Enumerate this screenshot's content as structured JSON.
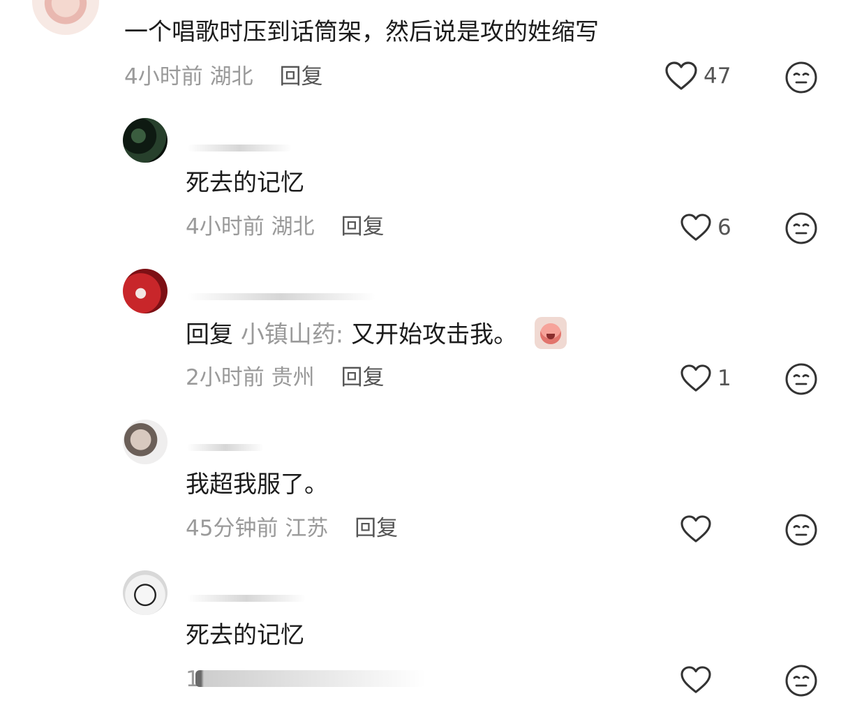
{
  "comments": [
    {
      "text": "一个唱歌时压到话筒架，然后说是攻的姓缩写",
      "time": "4小时前",
      "location": "湖北",
      "reply_label": "回复",
      "likes": "47"
    },
    {
      "text": "死去的记忆",
      "time": "4小时前",
      "location": "湖北",
      "reply_label": "回复",
      "likes": "6"
    },
    {
      "reply_prefix": "回复",
      "reply_target": "小镇山药:",
      "text": "又开始攻击我。",
      "time": "2小时前",
      "location": "贵州",
      "reply_label": "回复",
      "likes": "1"
    },
    {
      "text": "我超我服了。",
      "time": "45分钟前",
      "location": "江苏",
      "reply_label": "回复",
      "likes": ""
    },
    {
      "text": "死去的记忆",
      "time": "1",
      "likes": ""
    }
  ],
  "icons": {
    "like": "heart-outline-icon",
    "dislike": "neutral-face-icon",
    "sticker": "crying-face-sticker"
  },
  "colors": {
    "text": "#1c1c1c",
    "meta": "#9a9a9a",
    "icon": "#333333"
  }
}
